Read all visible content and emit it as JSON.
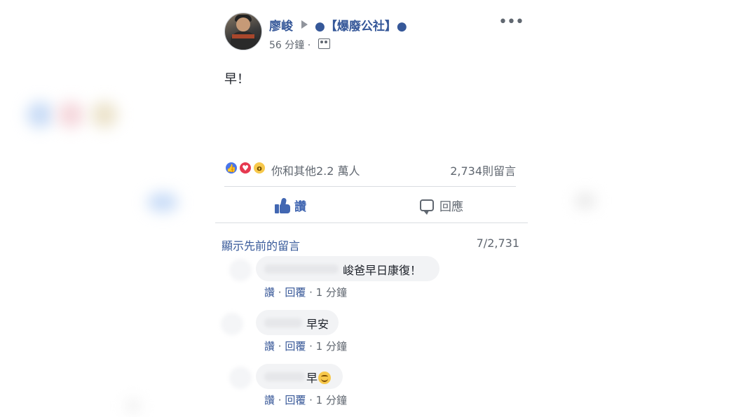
{
  "post": {
    "author": "廖峻",
    "group": "●【爆廢公社】●",
    "time": "56 分鐘 ·",
    "text": "早！"
  },
  "reactions": {
    "summary": "你和其他2.2 萬人",
    "comment_count": "2,734則留言",
    "icons": [
      "like-icon",
      "love-icon",
      "wow-icon"
    ]
  },
  "actions": {
    "like": "讚",
    "comment": "回應"
  },
  "comments_header": {
    "show_previous": "顯示先前的留言",
    "pager": "7/2,731"
  },
  "comments": [
    {
      "text": "峻爸早日康復！",
      "like": "讚",
      "sep1": " · ",
      "reply": "回覆",
      "sep2": " · ",
      "time": "1 分鐘"
    },
    {
      "text": "早安",
      "like": "讚",
      "sep1": " · ",
      "reply": "回覆",
      "sep2": " · ",
      "time": "1 分鐘"
    },
    {
      "text": "早",
      "like": "讚",
      "sep1": " · ",
      "reply": "回覆",
      "sep2": " · ",
      "time": "1 分鐘"
    }
  ],
  "colors": {
    "link": "#365899",
    "like_blue": "#4267b2",
    "muted": "#606770",
    "bubble": "#f2f3f5"
  }
}
